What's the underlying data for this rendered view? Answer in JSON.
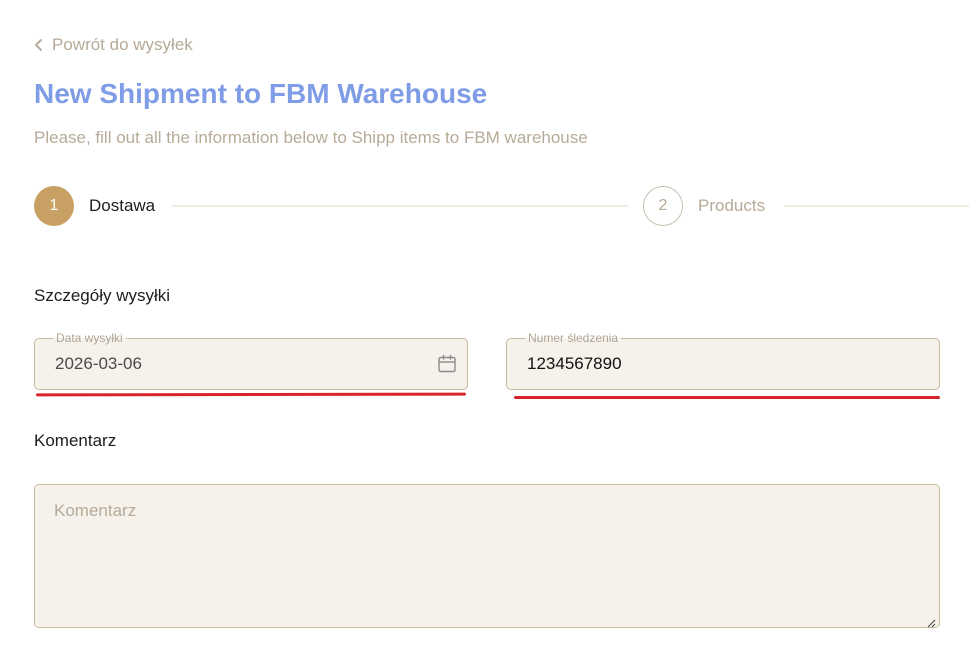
{
  "back_link": {
    "label": "Powrót do wysyłek",
    "icon": "chevron-left-icon"
  },
  "header": {
    "title": "New Shipment to FBM Warehouse",
    "subtitle": "Please, fill out all the information below to Shipp items to FBM warehouse"
  },
  "stepper": {
    "steps": [
      {
        "number": "1",
        "label": "Dostawa",
        "state": "active"
      },
      {
        "number": "2",
        "label": "Products",
        "state": "inactive"
      }
    ]
  },
  "details_section": {
    "title": "Szczegóły wysyłki",
    "shipment_date": {
      "label": "Data wysyłki",
      "value": "2026-03-06",
      "icon": "calendar-icon"
    },
    "tracking_number": {
      "label": "Numer śledzenia",
      "value": "1234567890"
    }
  },
  "comment_section": {
    "title": "Komentarz",
    "placeholder": "Komentarz",
    "value": ""
  },
  "colors": {
    "title_blue": "#7f9ce6",
    "accent_gold": "#c9a063",
    "muted_text": "#b7aa98",
    "field_bg": "#f5f2ec",
    "field_border": "#c8b99e",
    "annotation_red": "#d9232a"
  }
}
